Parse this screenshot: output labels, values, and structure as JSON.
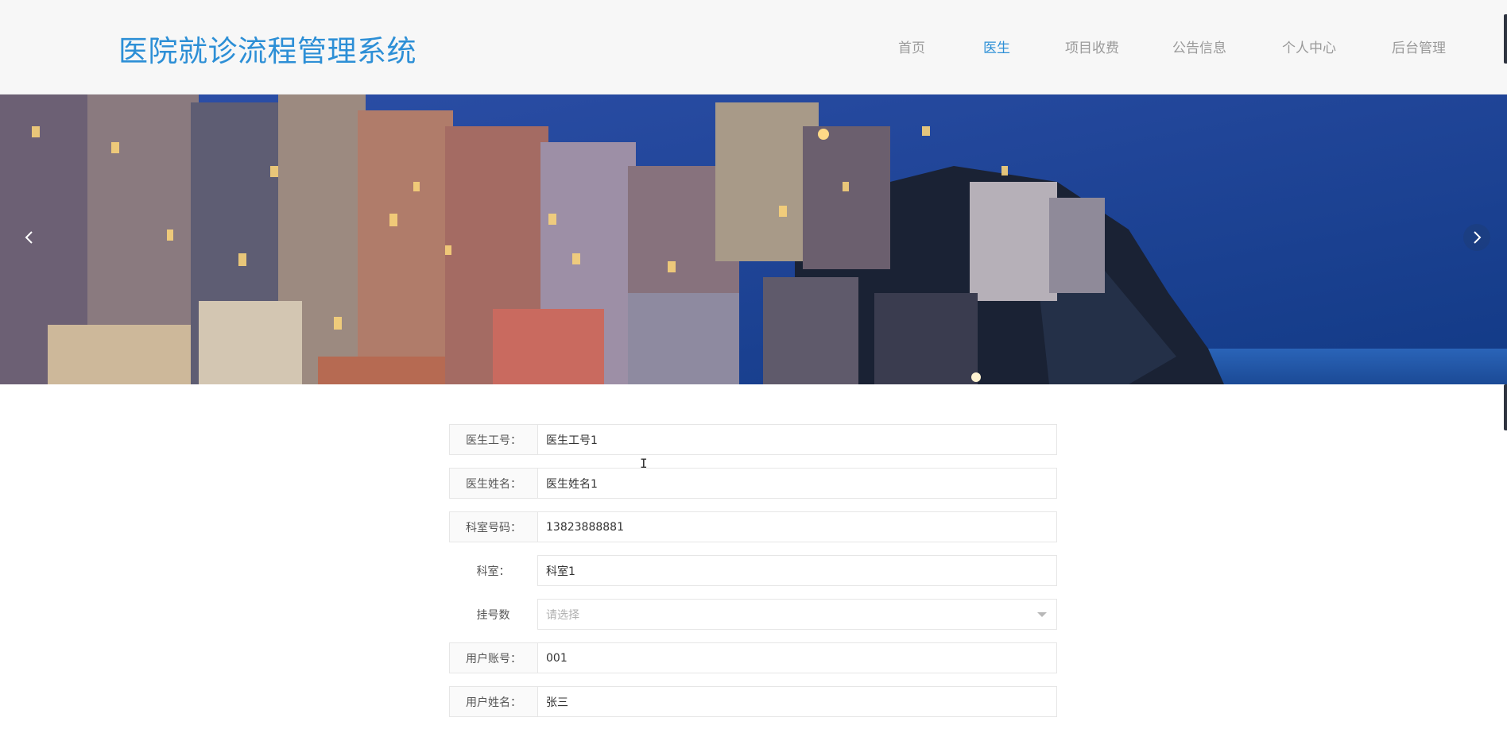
{
  "header": {
    "title": "医院就诊流程管理系统",
    "accent_color": "#2d8fd6",
    "nav": [
      {
        "label": "首页",
        "active": false
      },
      {
        "label": "医生",
        "active": true
      },
      {
        "label": "项目收费",
        "active": false
      },
      {
        "label": "公告信息",
        "active": false
      },
      {
        "label": "个人中心",
        "active": false
      },
      {
        "label": "后台管理",
        "active": false
      }
    ]
  },
  "banner": {
    "prev_icon": "chevron-left-icon",
    "next_icon": "chevron-right-icon"
  },
  "form": {
    "fields": [
      {
        "label": "医生工号：",
        "value": "医生工号1"
      },
      {
        "label": "医生姓名：",
        "value": "医生姓名1"
      },
      {
        "label": "科室号码：",
        "value": "13823888881"
      },
      {
        "label": "科室：",
        "value": "科室1"
      },
      {
        "label": "挂号数",
        "placeholder": "请选择"
      },
      {
        "label": "用户账号：",
        "value": "001"
      },
      {
        "label": "用户姓名：",
        "value": "张三"
      }
    ]
  }
}
